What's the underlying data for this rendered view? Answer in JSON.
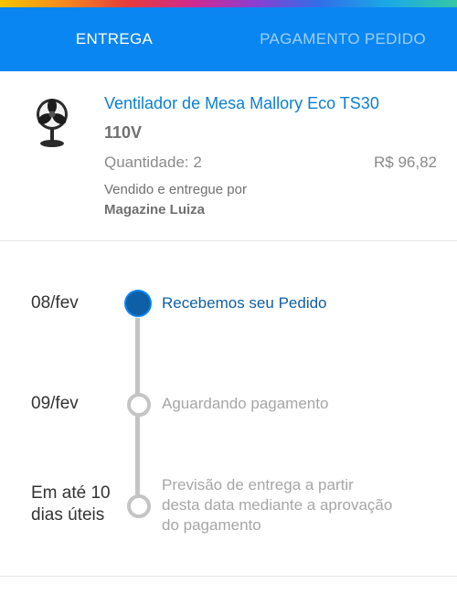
{
  "tabs": [
    {
      "label": "ENTREGA",
      "selected": true
    },
    {
      "label": "PAGAMENTO PEDIDO",
      "selected": false
    }
  ],
  "product": {
    "name": "Ventilador de Mesa Mallory Eco TS30",
    "voltage": "110V",
    "quantity": "Quantidade: 2",
    "price": "R$ 96,82",
    "sold_by_label": "Vendido e entregue por",
    "seller": "Magazine Luiza",
    "image_icon": "table-fan-image"
  },
  "timeline": [
    {
      "date": "08/fev",
      "event": "Recebemos seu Pedido",
      "status": "done"
    },
    {
      "date": "09/fev",
      "event": "Aguardando pagamento",
      "status": "pending"
    },
    {
      "date_line1": "Em até 10",
      "date_line2": "dias úteis",
      "event_line1": "Previsão de entrega a partir",
      "event_line2": "desta data mediante a aprovação",
      "event_line3": "do pagamento",
      "status": "pending"
    }
  ],
  "colors": {
    "primary": "#0a86f2",
    "link": "#0a7fd6",
    "active_step": "#0e5fa6",
    "inactive": "#c4c4c4"
  }
}
